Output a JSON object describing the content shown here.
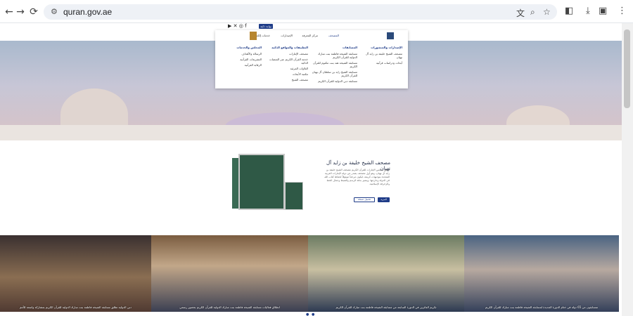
{
  "browser": {
    "url": "quran.gov.ae",
    "icons": [
      "back-icon",
      "forward-icon",
      "reload-icon",
      "site-settings-icon",
      "translate-icon",
      "zoom-icon",
      "bookmark-star-icon",
      "extensions-icon",
      "download-icon",
      "profile-icon",
      "menu-kebab-icon"
    ]
  },
  "header": {
    "util_button": "بوابة ذكية",
    "social_icons": [
      "youtube-icon",
      "twitter-icon",
      "instagram-icon",
      "facebook-icon"
    ],
    "nav": [
      "المصحف",
      "مركز المعرفة",
      "الإصدارات",
      "خدمات إلكترونية"
    ]
  },
  "mega_menu": {
    "col1_head": "المسابقات",
    "col1": [
      "مسابقة الشيخة فاطمة بنت مبارك الدولية للقرآن الكريم",
      "مسابقة الشيخة هند بنت مكتوم للقرآن الكريم",
      "مسابقة الشيخ زايد بن سلطان آل نهيان للقرآن الكريم",
      "مسابقة دبي الدولية للقرآن الكريم"
    ],
    "col2_head": "التطبيقات والمواقع الذكية",
    "col2": [
      "مصحف الإمارات",
      "خدمة القرآن الكريم عبر المنصات الذكية",
      "التلاوات المرئية",
      "مكتبة الأبحاث",
      "مصحف الشيخ"
    ],
    "col3_head": "المجلس والخدمات",
    "col3": [
      "الرسالة والأهداف",
      "التشريعات القرآنية",
      "الرقابة القرآنية"
    ],
    "col4_head": "الإصدارات والمنشورات",
    "col4": [
      "مصحف الشيخ خليفة بن زايد آل نهيان",
      "أبحاث ودراسات قرآنية"
    ]
  },
  "product": {
    "title": "مصحف الشيخ خليفة بن زايد آل نهيان",
    "description": "أطلق مجلس الإمارات للقرآن الكريم مصحف الشيخ خليفة بن زايد آل نهيان، وهو أول مصحف يصدر عن دولة الإمارات العربية المتحدة بتوجيهات كريمة، ليكون مرجعاً موثوقاً لحفاظ كتاب الله في الدولة وخارجها، ويتميز بدقة الرسم والضبط وجمال الخط والزخرفة الإسلامية.",
    "primary_btn": "المزيد",
    "secondary_btn": "تحميل نسخة"
  },
  "gallery": [
    {
      "caption": "دبي الدولية تطلق مسابقة الشيخة فاطمة بنت مبارك الدولية للقرآن الكريم بمشاركة واسعة للأمم"
    },
    {
      "caption": "انطلاق فعاليات مسابقة الشيخة فاطمة بنت مبارك الدولية للقرآن الكريم بحضور رسمي"
    },
    {
      "caption": "تكريم الفائزين في الدورة السابعة من مسابقة الشيخة فاطمة بنت مبارك للقرآن الكريم"
    },
    {
      "caption": "متسابقون من 65 دولة في ختام الدورة الجديدة لمسابقة الشيخة فاطمة بنت مبارك للقرآن الكريم"
    }
  ]
}
